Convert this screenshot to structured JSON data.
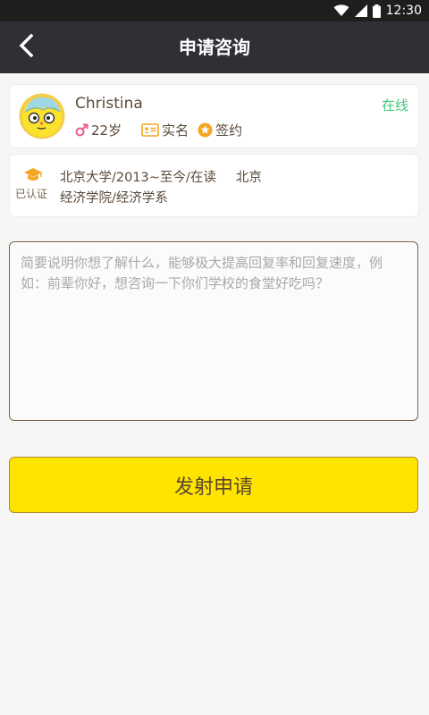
{
  "status_bar": {
    "time": "12:30"
  },
  "header": {
    "title": "申请咨询"
  },
  "profile": {
    "name": "Christina",
    "status": "在线",
    "age": "22岁",
    "real_name_label": "实名",
    "signed_label": "签约"
  },
  "education": {
    "verified_label": "已认证",
    "school_line": "北京大学/2013~至今/在读",
    "location": "北京",
    "department_line": "经济学院/经济学系"
  },
  "message": {
    "placeholder": "简要说明你想了解什么，能够极大提高回复率和回复速度，例如：前辈你好，想咨询一下你们学校的食堂好吃吗？",
    "value": ""
  },
  "submit": {
    "label": "发射申请"
  },
  "colors": {
    "app_bar": "#2f2f36",
    "accent_yellow": "#ffe400",
    "online_green": "#43c77a",
    "badge_orange": "#f5a623",
    "male_pink": "#ef5a8a"
  },
  "icons": [
    "back-arrow-icon",
    "wifi-icon",
    "signal-icon",
    "battery-icon",
    "male-icon",
    "id-card-icon",
    "star-badge-icon",
    "graduation-cap-icon"
  ]
}
